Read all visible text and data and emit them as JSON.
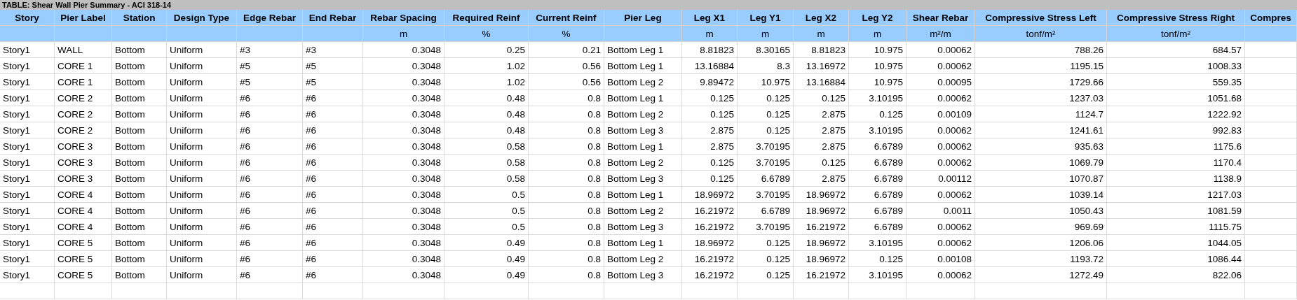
{
  "title": "TABLE:  Shear Wall Pier Summary - ACI 318-14",
  "columns": [
    {
      "label": "Story",
      "kind": "text"
    },
    {
      "label": "Pier Label",
      "kind": "text"
    },
    {
      "label": "Station",
      "kind": "text"
    },
    {
      "label": "Design Type",
      "kind": "text"
    },
    {
      "label": "Edge Rebar",
      "kind": "text"
    },
    {
      "label": "End Rebar",
      "kind": "text"
    },
    {
      "label": "Rebar Spacing",
      "unit": "m",
      "kind": "number"
    },
    {
      "label": "Required Reinf",
      "unit": "%",
      "kind": "number"
    },
    {
      "label": "Current Reinf",
      "unit": "%",
      "kind": "number"
    },
    {
      "label": "Pier Leg",
      "kind": "text"
    },
    {
      "label": "Leg X1",
      "unit": "m",
      "kind": "number"
    },
    {
      "label": "Leg Y1",
      "unit": "m",
      "kind": "number"
    },
    {
      "label": "Leg X2",
      "unit": "m",
      "kind": "number"
    },
    {
      "label": "Leg Y2",
      "unit": "m",
      "kind": "number"
    },
    {
      "label": "Shear Rebar",
      "unit": "m²/m",
      "kind": "number"
    },
    {
      "label": "Compressive Stress Left",
      "unit": "tonf/m²",
      "kind": "number"
    },
    {
      "label": "Compressive Stress Right",
      "unit": "tonf/m²",
      "kind": "number"
    },
    {
      "label": "Compres",
      "kind": "text"
    }
  ],
  "rows": [
    [
      "Story1",
      "WALL",
      "Bottom",
      "Uniform",
      "#3",
      "#3",
      "0.3048",
      "0.25",
      "0.21",
      "Bottom Leg 1",
      "8.81823",
      "8.30165",
      "8.81823",
      "10.975",
      "0.00062",
      "788.26",
      "684.57"
    ],
    [
      "Story1",
      "CORE 1",
      "Bottom",
      "Uniform",
      "#5",
      "#5",
      "0.3048",
      "1.02",
      "0.56",
      "Bottom Leg 1",
      "13.16884",
      "8.3",
      "13.16972",
      "10.975",
      "0.00062",
      "1195.15",
      "1008.33"
    ],
    [
      "Story1",
      "CORE 1",
      "Bottom",
      "Uniform",
      "#5",
      "#5",
      "0.3048",
      "1.02",
      "0.56",
      "Bottom Leg 2",
      "9.89472",
      "10.975",
      "13.16884",
      "10.975",
      "0.00095",
      "1729.66",
      "559.35"
    ],
    [
      "Story1",
      "CORE 2",
      "Bottom",
      "Uniform",
      "#6",
      "#6",
      "0.3048",
      "0.48",
      "0.8",
      "Bottom Leg 1",
      "0.125",
      "0.125",
      "0.125",
      "3.10195",
      "0.00062",
      "1237.03",
      "1051.68"
    ],
    [
      "Story1",
      "CORE 2",
      "Bottom",
      "Uniform",
      "#6",
      "#6",
      "0.3048",
      "0.48",
      "0.8",
      "Bottom Leg 2",
      "0.125",
      "0.125",
      "2.875",
      "0.125",
      "0.00109",
      "1124.7",
      "1222.92"
    ],
    [
      "Story1",
      "CORE 2",
      "Bottom",
      "Uniform",
      "#6",
      "#6",
      "0.3048",
      "0.48",
      "0.8",
      "Bottom Leg 3",
      "2.875",
      "0.125",
      "2.875",
      "3.10195",
      "0.00062",
      "1241.61",
      "992.83"
    ],
    [
      "Story1",
      "CORE 3",
      "Bottom",
      "Uniform",
      "#6",
      "#6",
      "0.3048",
      "0.58",
      "0.8",
      "Bottom Leg 1",
      "2.875",
      "3.70195",
      "2.875",
      "6.6789",
      "0.00062",
      "935.63",
      "1175.6"
    ],
    [
      "Story1",
      "CORE 3",
      "Bottom",
      "Uniform",
      "#6",
      "#6",
      "0.3048",
      "0.58",
      "0.8",
      "Bottom Leg 2",
      "0.125",
      "3.70195",
      "0.125",
      "6.6789",
      "0.00062",
      "1069.79",
      "1170.4"
    ],
    [
      "Story1",
      "CORE 3",
      "Bottom",
      "Uniform",
      "#6",
      "#6",
      "0.3048",
      "0.58",
      "0.8",
      "Bottom Leg 3",
      "0.125",
      "6.6789",
      "2.875",
      "6.6789",
      "0.00112",
      "1070.87",
      "1138.9"
    ],
    [
      "Story1",
      "CORE 4",
      "Bottom",
      "Uniform",
      "#6",
      "#6",
      "0.3048",
      "0.5",
      "0.8",
      "Bottom Leg 1",
      "18.96972",
      "3.70195",
      "18.96972",
      "6.6789",
      "0.00062",
      "1039.14",
      "1217.03"
    ],
    [
      "Story1",
      "CORE 4",
      "Bottom",
      "Uniform",
      "#6",
      "#6",
      "0.3048",
      "0.5",
      "0.8",
      "Bottom Leg 2",
      "16.21972",
      "6.6789",
      "18.96972",
      "6.6789",
      "0.0011",
      "1050.43",
      "1081.59"
    ],
    [
      "Story1",
      "CORE 4",
      "Bottom",
      "Uniform",
      "#6",
      "#6",
      "0.3048",
      "0.5",
      "0.8",
      "Bottom Leg 3",
      "16.21972",
      "3.70195",
      "16.21972",
      "6.6789",
      "0.00062",
      "969.69",
      "1115.75"
    ],
    [
      "Story1",
      "CORE 5",
      "Bottom",
      "Uniform",
      "#6",
      "#6",
      "0.3048",
      "0.49",
      "0.8",
      "Bottom Leg 1",
      "18.96972",
      "0.125",
      "18.96972",
      "3.10195",
      "0.00062",
      "1206.06",
      "1044.05"
    ],
    [
      "Story1",
      "CORE 5",
      "Bottom",
      "Uniform",
      "#6",
      "#6",
      "0.3048",
      "0.49",
      "0.8",
      "Bottom Leg 2",
      "16.21972",
      "0.125",
      "18.96972",
      "0.125",
      "0.00108",
      "1193.72",
      "1086.44"
    ],
    [
      "Story1",
      "CORE 5",
      "Bottom",
      "Uniform",
      "#6",
      "#6",
      "0.3048",
      "0.49",
      "0.8",
      "Bottom Leg 3",
      "16.21972",
      "0.125",
      "16.21972",
      "3.10195",
      "0.00062",
      "1272.49",
      "822.06"
    ]
  ]
}
